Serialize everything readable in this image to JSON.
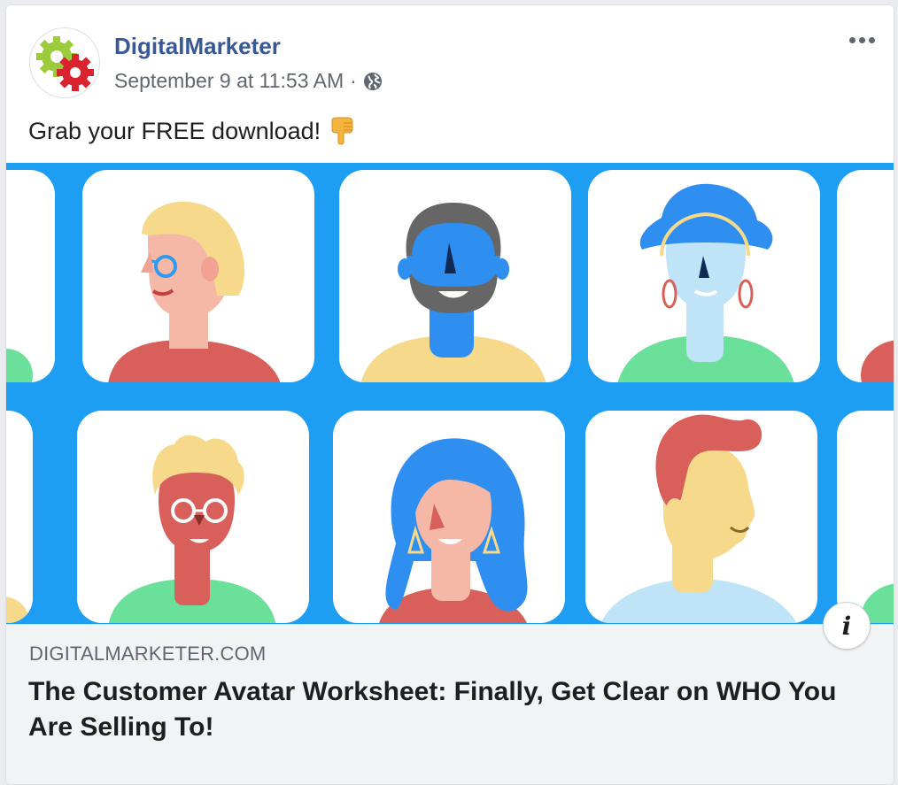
{
  "post": {
    "page_name": "DigitalMarketer",
    "timestamp": "September 9 at 11:53 AM",
    "separator": "·",
    "privacy_icon": "globe-icon",
    "more_icon": "more-options-icon",
    "text": "Grab your FREE download!",
    "emoji_icon": "backhand-index-pointing-down-icon"
  },
  "link_preview": {
    "domain": "DIGITALMARKETER.COM",
    "title": "The Customer Avatar Worksheet: Finally, Get Clear on WHO You Are Selling To!",
    "info_icon": "info-icon",
    "info_label": "i"
  },
  "colors": {
    "page_name": "#385898",
    "hero_background": "#1d9ef3",
    "link_background": "#f2f3f5",
    "logo_green": "#9ccb3b",
    "logo_red": "#d9232e"
  }
}
